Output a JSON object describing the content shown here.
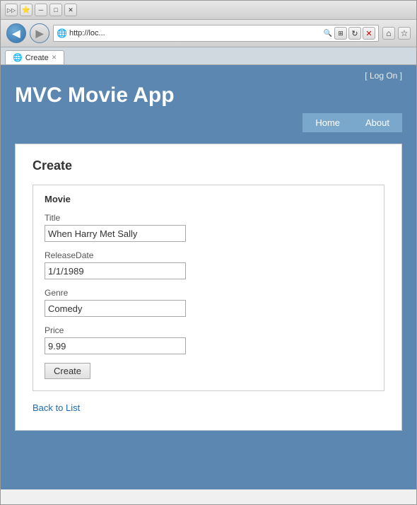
{
  "browser": {
    "address": "http://loc...",
    "tab_title": "Create",
    "back_tooltip": "Back",
    "forward_tooltip": "Forward"
  },
  "app": {
    "logon_label": "[ Log On ]",
    "title": "MVC Movie App",
    "nav": {
      "home_label": "Home",
      "about_label": "About"
    }
  },
  "page": {
    "title": "Create",
    "form_section_title": "Movie",
    "fields": {
      "title_label": "Title",
      "title_value": "When Harry Met Sally",
      "release_date_label": "ReleaseDate",
      "release_date_value": "1/1/1989",
      "genre_label": "Genre",
      "genre_value": "Comedy",
      "price_label": "Price",
      "price_value": "9.99"
    },
    "submit_label": "Create",
    "back_link_label": "Back to List"
  },
  "icons": {
    "back": "◀",
    "forward": "▶",
    "ie": "🌐",
    "search": "🔍",
    "refresh": "↻",
    "close_tab": "✕",
    "home": "⌂",
    "star": "☆",
    "tools": "⚙",
    "pin": "▷▷",
    "minimize": "─",
    "maximize": "□",
    "close": "✕"
  }
}
